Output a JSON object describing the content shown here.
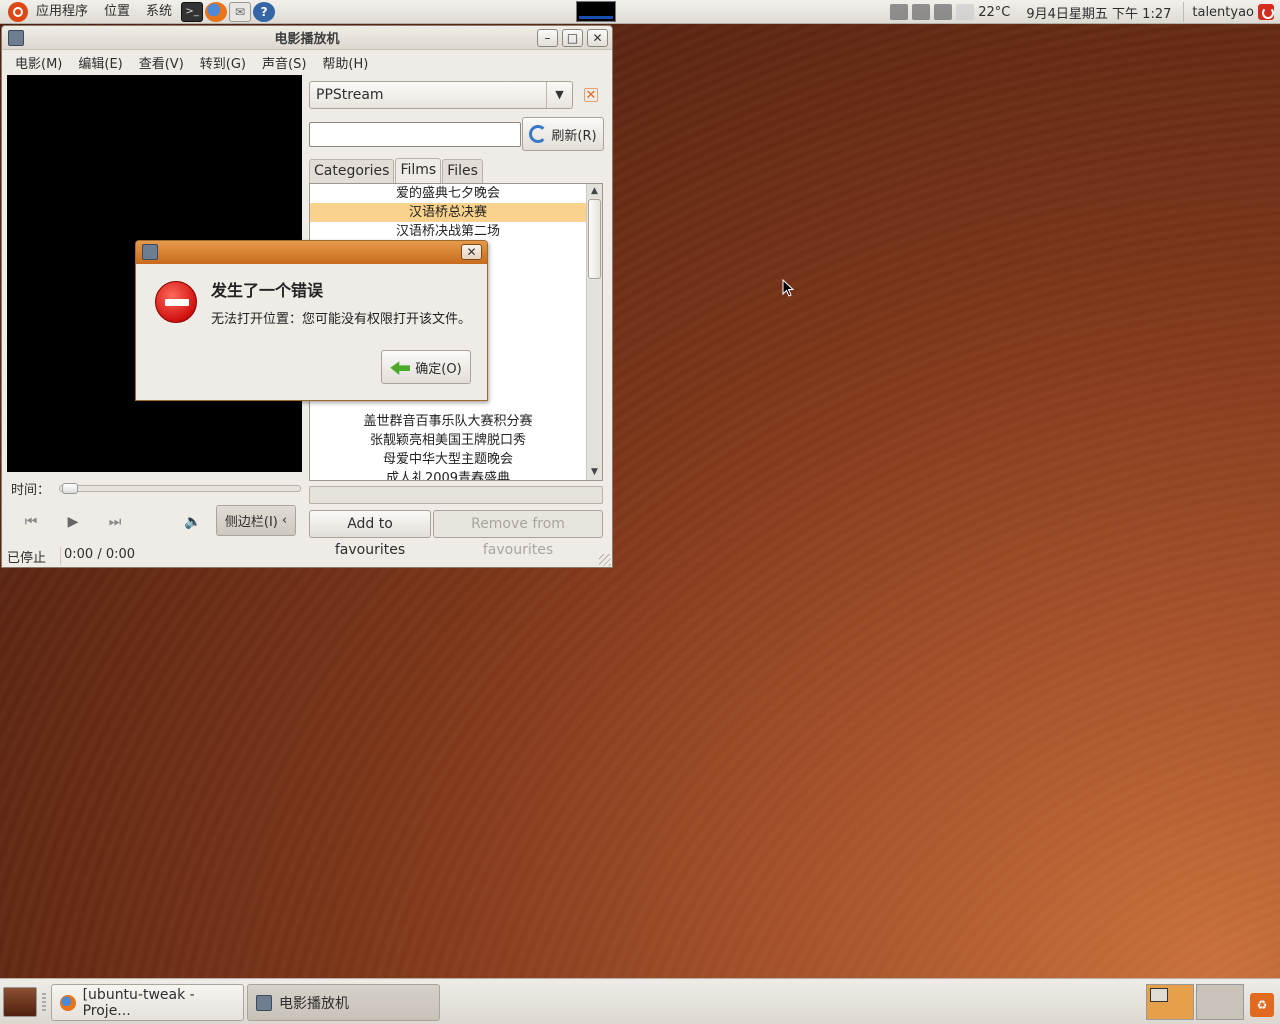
{
  "top_panel": {
    "menus": [
      "应用程序",
      "位置",
      "系统"
    ],
    "launchers": [
      "terminal-icon",
      "firefox-icon",
      "mail-icon",
      "help-icon"
    ],
    "temperature": "22°C",
    "datetime": "9月4日星期五 下午 1:27",
    "username": "talentyao"
  },
  "window": {
    "title": "电影播放机",
    "menu": [
      "电影(M)",
      "编辑(E)",
      "查看(V)",
      "转到(G)",
      "声音(S)",
      "帮助(H)"
    ],
    "time_label": "时间：",
    "sidebar_button": "侧边栏(I)",
    "status": "已停止",
    "time_display": "0:00 / 0:00"
  },
  "sidebar": {
    "plugin_selected": "PPStream",
    "search_value": "",
    "refresh_label": "刷新(R)",
    "tabs": [
      "Categories",
      "Films",
      "Files"
    ],
    "active_tab": "Films",
    "items": [
      "爱的盛典七夕晚会",
      "汉语桥总决赛",
      "汉语桥决战第二场",
      "",
      "",
      "",
      "",
      "",
      "",
      "",
      "",
      "",
      "盖世群音百事乐队大赛积分赛",
      "张靓颖亮相美国王牌脱口秀",
      "母爱中华大型主题晚会",
      "成人礼2009青春盛典"
    ],
    "selected_index": 1,
    "add_favourites": "Add to favourites",
    "remove_favourites": "Remove from favourites"
  },
  "dialog": {
    "heading": "发生了一个错误",
    "message": "无法打开位置：您可能没有权限打开该文件。",
    "ok_label": "确定(O)"
  },
  "bottom_panel": {
    "tasks": [
      "[ubuntu-tweak - Proje...",
      "电影播放机"
    ]
  },
  "colors": {
    "selection": "#f9d38e",
    "dialog_titlebar": "#d8802e",
    "error_red": "#d01010",
    "accent_orange": "#dd4814"
  }
}
